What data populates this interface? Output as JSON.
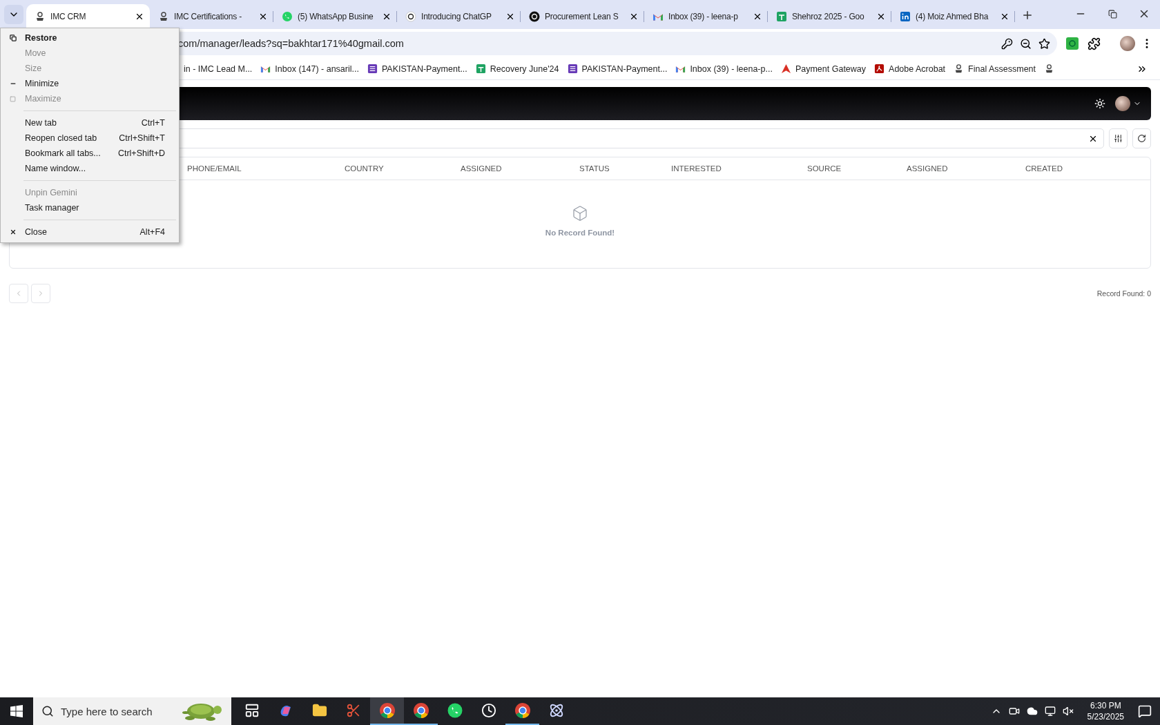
{
  "browser": {
    "tabs": [
      {
        "title": "IMC CRM",
        "kind": "imc",
        "selected": true
      },
      {
        "title": "IMC Certifications -",
        "kind": "imc",
        "selected": false
      },
      {
        "title": "(5) WhatsApp Busine",
        "kind": "whatsapp",
        "selected": false
      },
      {
        "title": "Introducing ChatGP",
        "kind": "openai",
        "selected": false
      },
      {
        "title": "Procurement Lean S",
        "kind": "openaidark",
        "selected": false
      },
      {
        "title": "Inbox (39) - leena-p",
        "kind": "gmail",
        "selected": false
      },
      {
        "title": "Shehroz 2025 - Goo",
        "kind": "sheets",
        "selected": false
      },
      {
        "title": "(4) Moiz Ahmed Bha",
        "kind": "linkedin",
        "selected": false
      }
    ],
    "address": "com/manager/leads?sq=bakhtar171%40gmail.com",
    "bookmarks": [
      {
        "label": "in - IMC Lead M...",
        "kind": "plain"
      },
      {
        "label": "Inbox (147) - ansaril...",
        "kind": "gmail"
      },
      {
        "label": "PAKISTAN-Payment...",
        "kind": "forms"
      },
      {
        "label": "Recovery June'24",
        "kind": "sheets"
      },
      {
        "label": "PAKISTAN-Payment...",
        "kind": "forms"
      },
      {
        "label": "Inbox (39) - leena-p...",
        "kind": "gmail"
      },
      {
        "label": "Payment Gateway",
        "kind": "arrow"
      },
      {
        "label": "Adobe Acrobat",
        "kind": "acrobat"
      },
      {
        "label": "Final Assessment",
        "kind": "imc"
      },
      {
        "kind": "imc"
      }
    ]
  },
  "app": {
    "columns": [
      "PHONE/EMAIL",
      "COUNTRY",
      "ASSIGNED",
      "STATUS",
      "INTERESTED",
      "SOURCE",
      "ASSIGNED",
      "CREATED"
    ],
    "empty_message": "No Record Found!",
    "record_count": "Record Found: 0"
  },
  "system_menu": {
    "sections": [
      [
        {
          "label": "Restore",
          "kind": "restore",
          "disabled": false,
          "bold": true
        },
        {
          "label": "Move",
          "kind": "plain",
          "disabled": true,
          "bold": false
        },
        {
          "label": "Size",
          "kind": "plain",
          "disabled": true,
          "bold": false
        },
        {
          "label": "Minimize",
          "kind": "minimize",
          "disabled": false,
          "bold": false
        },
        {
          "label": "Maximize",
          "kind": "maximize",
          "disabled": true,
          "bold": false
        }
      ],
      [
        {
          "label": "New tab",
          "shortcut": "Ctrl+T",
          "kind": "plain",
          "disabled": false,
          "bold": false
        },
        {
          "label": "Reopen closed tab",
          "shortcut": "Ctrl+Shift+T",
          "kind": "plain",
          "disabled": false,
          "bold": false
        },
        {
          "label": "Bookmark all tabs...",
          "shortcut": "Ctrl+Shift+D",
          "kind": "plain",
          "disabled": false,
          "bold": false
        },
        {
          "label": "Name window...",
          "kind": "plain",
          "disabled": false,
          "bold": false
        }
      ],
      [
        {
          "label": "Unpin Gemini",
          "kind": "plain",
          "disabled": true,
          "bold": false
        },
        {
          "label": "Task manager",
          "kind": "plain",
          "disabled": false,
          "bold": false
        }
      ],
      [
        {
          "label": "Close",
          "shortcut": "Alt+F4",
          "kind": "close",
          "disabled": false,
          "bold": false
        }
      ]
    ]
  },
  "taskbar": {
    "search_placeholder": "Type here to search",
    "apps": [
      {
        "kind": "taskview",
        "running": false,
        "selected": false
      },
      {
        "kind": "copilot",
        "running": false,
        "selected": false
      },
      {
        "kind": "folder",
        "running": false,
        "selected": false
      },
      {
        "kind": "snip",
        "running": false,
        "selected": false
      },
      {
        "kind": "chrome",
        "running": true,
        "selected": true
      },
      {
        "kind": "chrome",
        "running": true,
        "selected": false
      },
      {
        "kind": "whatsapp",
        "running": false,
        "selected": false
      },
      {
        "kind": "clock",
        "running": false,
        "selected": false
      },
      {
        "kind": "chrome",
        "running": true,
        "selected": false
      },
      {
        "kind": "atom",
        "running": false,
        "selected": false
      }
    ],
    "time": "6:30 PM",
    "date": "5/23/2025"
  }
}
